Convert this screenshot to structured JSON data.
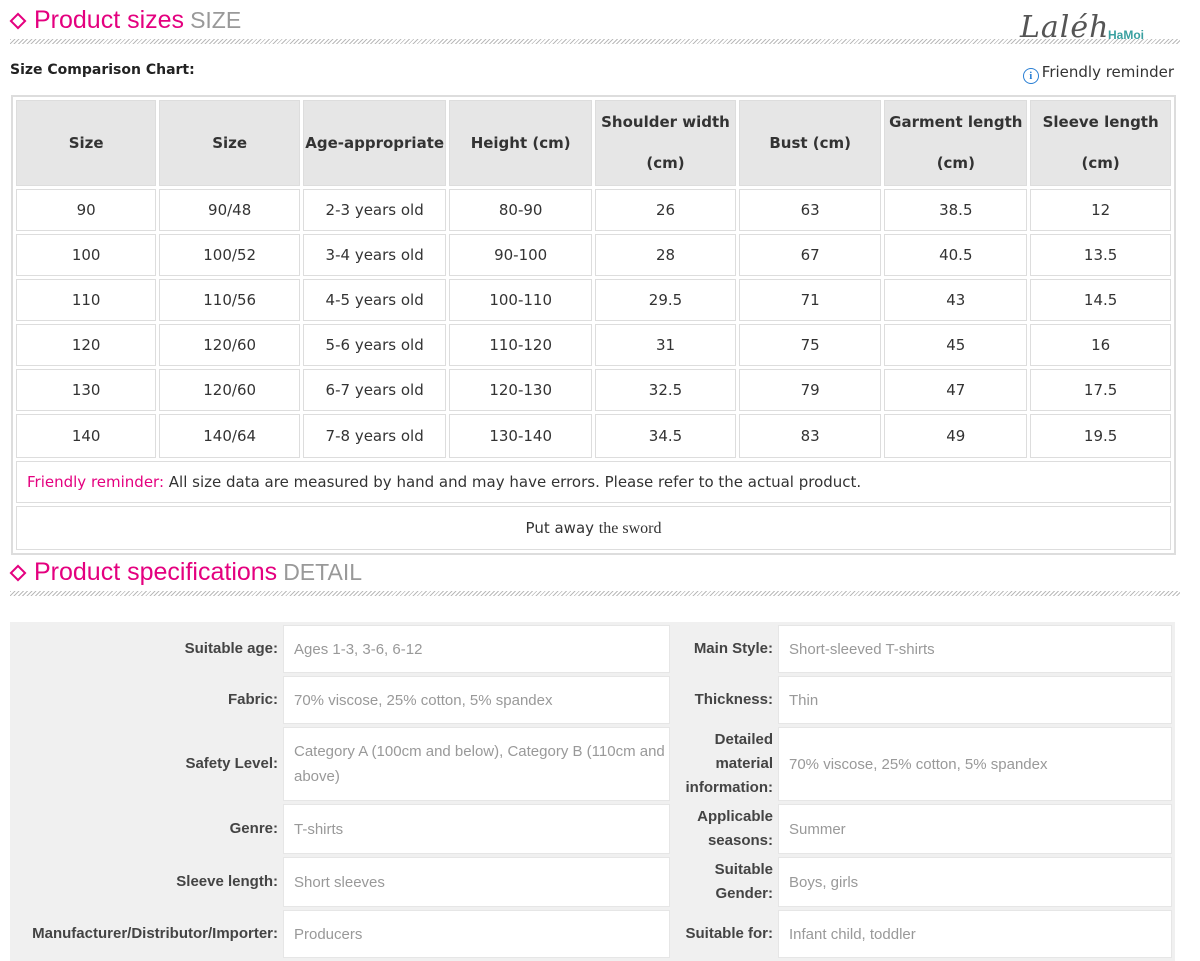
{
  "sizes_section": {
    "title": "Product sizes",
    "title_en": "SIZE"
  },
  "logo": {
    "script": "Laléh",
    "brand": "HaMoi"
  },
  "chart_label": "Size Comparison Chart:",
  "reminder_link": "Friendly reminder",
  "size_table": {
    "headers": [
      {
        "l1": "Size",
        "l2": ""
      },
      {
        "l1": "Size",
        "l2": ""
      },
      {
        "l1": "Age-appropriate",
        "l2": ""
      },
      {
        "l1": "Height (cm)",
        "l2": ""
      },
      {
        "l1": "Shoulder width",
        "l2": "(cm)"
      },
      {
        "l1": "Bust (cm)",
        "l2": ""
      },
      {
        "l1": "Garment length",
        "l2": "(cm)"
      },
      {
        "l1": "Sleeve length",
        "l2": "(cm)"
      }
    ],
    "rows": [
      [
        "90",
        "90/48",
        "2-3 years old",
        "80-90",
        "26",
        "63",
        "38.5",
        "12"
      ],
      [
        "100",
        "100/52",
        "3-4 years old",
        "90-100",
        "28",
        "67",
        "40.5",
        "13.5"
      ],
      [
        "110",
        "110/56",
        "4-5 years old",
        "100-110",
        "29.5",
        "71",
        "43",
        "14.5"
      ],
      [
        "120",
        "120/60",
        "5-6 years old",
        "110-120",
        "31",
        "75",
        "45",
        "16"
      ],
      [
        "130",
        "120/60",
        "6-7 years old",
        "120-130",
        "32.5",
        "79",
        "47",
        "17.5"
      ],
      [
        "140",
        "140/64",
        "7-8 years old",
        "130-140",
        "34.5",
        "83",
        "49",
        "19.5"
      ]
    ],
    "note_label": "Friendly reminder:",
    "note_text": " All size data are measured by hand and may have errors. Please refer to the actual product.",
    "put_away_a": "Put away",
    "put_away_b": "the sword"
  },
  "detail_section": {
    "title": "Product specifications",
    "title_en": "DETAIL"
  },
  "specs": [
    {
      "k1": "Suitable age:",
      "v1": "Ages 1-3, 3-6, 6-12",
      "k2": "Main Style:",
      "v2": "Short-sleeved T-shirts"
    },
    {
      "k1": "Fabric:",
      "v1": "70% viscose, 25% cotton, 5% spandex",
      "k2": "Thickness:",
      "v2": "Thin"
    },
    {
      "k1": "Safety Level:",
      "v1": "Category A (100cm and below), Category B (110cm and above)",
      "k2": "Detailed material information:",
      "v2": "70% viscose, 25% cotton, 5% spandex"
    },
    {
      "k1": "Genre:",
      "v1": "T-shirts",
      "k2": "Applicable seasons:",
      "v2": "Summer"
    },
    {
      "k1": "Sleeve length:",
      "v1": "Short sleeves",
      "k2": "Suitable Gender:",
      "v2": "Boys, girls"
    },
    {
      "k1": "Manufacturer/Distributor/Importer:",
      "v1": "Producers",
      "k2": "Suitable for:",
      "v2": "Infant child, toddler"
    }
  ]
}
